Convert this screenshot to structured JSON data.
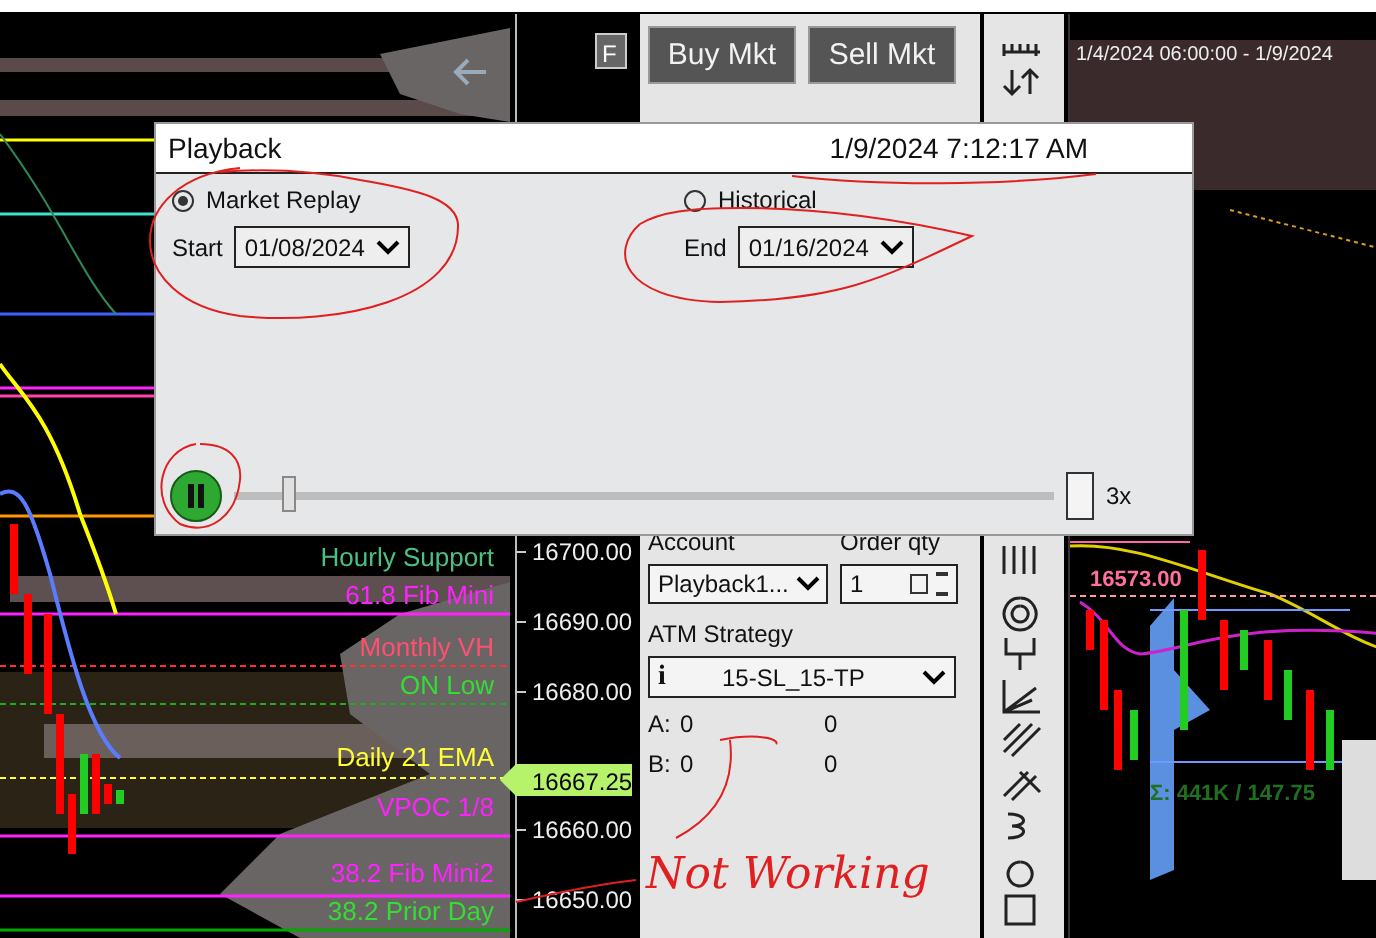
{
  "left_chart": {
    "labels": [
      {
        "text": "Hourly Support",
        "color": "#4cc080"
      },
      {
        "text": "61.8 Fib Mini",
        "color": "#ff22ff"
      },
      {
        "text": "Monthly VH",
        "color": "#ff5070"
      },
      {
        "text": "ON Low",
        "color": "#33dd33"
      },
      {
        "text": "Daily 21 EMA",
        "color": "#ffff33"
      },
      {
        "text": "VPOC 1/8",
        "color": "#ff22ff"
      },
      {
        "text": "38.2 Fib Mini2",
        "color": "#ff22ff"
      },
      {
        "text": "38.2 Prior Day",
        "color": "#33dd33"
      }
    ],
    "price_ticks": [
      "16700.00",
      "16690.00",
      "16680.00",
      "16660.00",
      "16650.00"
    ],
    "last_price": "16667.25",
    "f_button": "F"
  },
  "order_panel": {
    "buttons": [
      "Buy Mkt",
      "Sell Mkt"
    ],
    "account_label": "Account",
    "account": "Playback1...",
    "qty_label": "Order qty",
    "qty": "1",
    "atm_label": "ATM Strategy",
    "atm_info": "i",
    "atm": "15-SL_15-TP",
    "rows": [
      {
        "label": "A:",
        "value": "0",
        "value_2": "0"
      },
      {
        "label": "B:",
        "value": "0",
        "value_2": "0"
      }
    ]
  },
  "right_chart": {
    "range": "1/4/2024 06:00:00 - 1/9/2024",
    "price_label": "16573.00",
    "volume_label": "Σ: 441K / 147.75"
  },
  "dialog": {
    "title": "Playback",
    "time": "1/9/2024 7:12:17 AM",
    "modes": [
      {
        "label": "Market Replay",
        "selected": true,
        "date_label": "Start",
        "date": "01/08/2024"
      },
      {
        "label": "Historical",
        "selected": false,
        "date_label": "End",
        "date": "01/16/2024"
      }
    ],
    "playing": true,
    "slider": {
      "level": 0.06
    },
    "speed": "3x"
  },
  "annotation": {
    "text": "Not Working"
  }
}
